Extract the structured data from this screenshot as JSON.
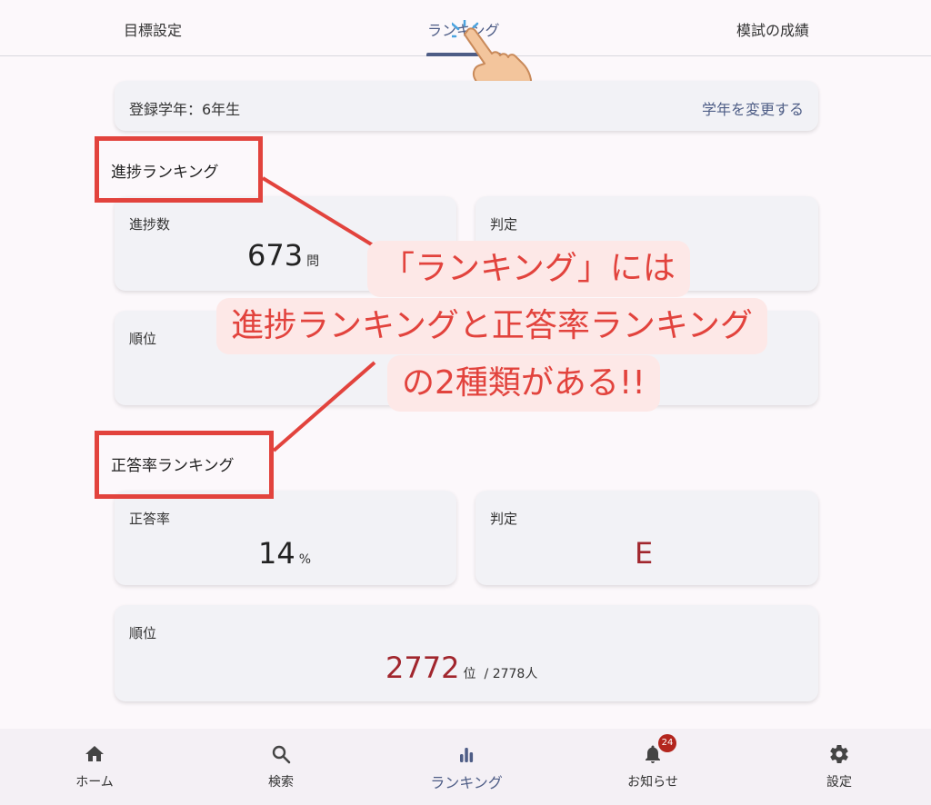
{
  "top_tabs": [
    "目標設定",
    "ランキング",
    "模試の成績"
  ],
  "grade": {
    "label": "登録学年：6年生",
    "change": "学年を変更する"
  },
  "progress_ranking": {
    "title": "進捗ランキング",
    "count_label": "進捗数",
    "count_value": "673",
    "count_unit": "問",
    "judge_label": "判定",
    "rank_label": "順位"
  },
  "accuracy_ranking": {
    "title": "正答率ランキング",
    "rate_label": "正答率",
    "rate_value": "14",
    "rate_unit": "%",
    "judge_label": "判定",
    "judge_value": "E",
    "rank_label": "順位",
    "rank_value": "2772",
    "rank_unit": "位",
    "rank_total": "/ 2778人"
  },
  "callout": {
    "line1": "「ランキング」には",
    "line2": "進捗ランキングと正答率ランキング",
    "line3": "の2種類がある!!"
  },
  "bottom_nav": {
    "items": [
      {
        "label": "ホーム",
        "icon": "home-icon"
      },
      {
        "label": "検索",
        "icon": "search-icon"
      },
      {
        "label": "ランキング",
        "icon": "bar-chart-icon"
      },
      {
        "label": "お知らせ",
        "icon": "bell-icon"
      },
      {
        "label": "設定",
        "icon": "gear-icon"
      }
    ],
    "badge": "24"
  },
  "colors": {
    "accent": "#4e5d86",
    "annotation_red": "#e2433d",
    "grade_red": "#a1262d"
  }
}
